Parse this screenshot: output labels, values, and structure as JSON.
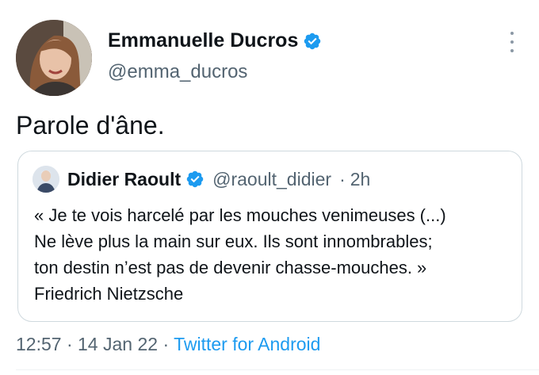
{
  "author": {
    "name": "Emmanuelle Ducros",
    "handle": "@emma_ducros",
    "verified": true
  },
  "tweet": {
    "text": "Parole d'âne."
  },
  "quote": {
    "author_name": "Didier Raoult",
    "handle": "@raoult_didier",
    "separator": "·",
    "time": "2h",
    "lines": [
      "« Je te vois harcelé par les mouches venimeuses (...)",
      "Ne lève plus la main sur eux. Ils sont innombrables;",
      "ton destin n’est pas de devenir chasse-mouches. »",
      "Friedrich Nietzsche"
    ]
  },
  "footer": {
    "time": "12:57",
    "separator": "·",
    "date": "14 Jan 22",
    "source": "Twitter for Android"
  },
  "icons": {
    "verified": "verified-badge-icon",
    "more": "more-options-icon"
  },
  "colors": {
    "accent": "#1d9bf0",
    "text": "#0f1419",
    "secondary": "#536471",
    "border": "#cfd9de"
  }
}
